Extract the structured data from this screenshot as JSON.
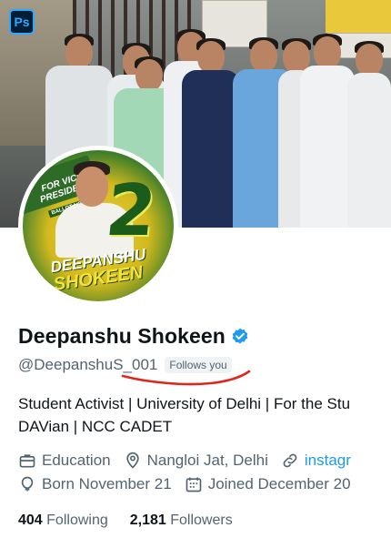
{
  "app": {
    "badge_label": "Ps"
  },
  "profile": {
    "name": "Deepanshu Shokeen",
    "handle": "@DeepanshuS_001",
    "follows_you": "Follows you",
    "bio_line1": "Student Activist | University of Delhi | For the Stu",
    "bio_line2": "DAVian | NCC CADET",
    "category": "Education",
    "location": "Nangloi Jat, Delhi",
    "website": "instagr",
    "birthday": "Born November 21",
    "joined": "Joined December 20",
    "following_count": "404",
    "following_label": "Following",
    "followers_count": "2,181",
    "followers_label": "Followers"
  },
  "avatar_poster": {
    "title": "FOR VICE PRESIDENT",
    "ballot": "BALLOT NO.",
    "number": "2",
    "name_top": "DEEPANSHU",
    "name_bottom": "SHOKEEN"
  },
  "colors": {
    "accent": "#1d9bf0",
    "text": "#0f1419",
    "secondary": "#536471",
    "annotation": "#e0251b"
  },
  "icons": [
    "photoshop-icon",
    "verified-badge-icon",
    "briefcase-icon",
    "location-pin-icon",
    "link-icon",
    "balloon-icon",
    "calendar-icon"
  ]
}
